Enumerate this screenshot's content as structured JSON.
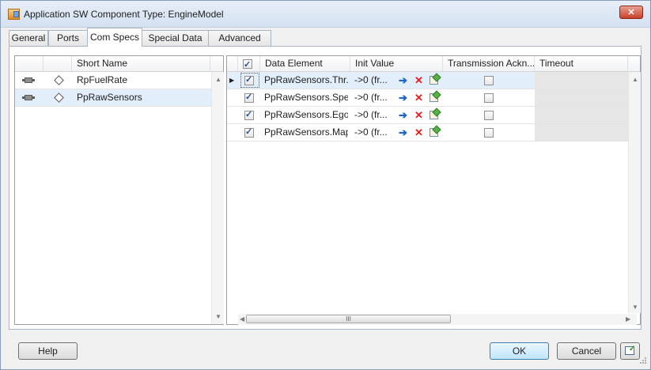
{
  "window": {
    "title": "Application SW Component Type: EngineModel",
    "close_symbol": "✕"
  },
  "tabs": [
    {
      "label": "General",
      "active": false
    },
    {
      "label": "Ports",
      "active": false
    },
    {
      "label": "Com Specs",
      "active": true
    },
    {
      "label": "Special Data",
      "active": false
    },
    {
      "label": "Advanced",
      "active": false
    }
  ],
  "left_table": {
    "header": "Short Name",
    "rows": [
      {
        "name": "RpFuelRate",
        "selected": false
      },
      {
        "name": "PpRawSensors",
        "selected": true
      }
    ]
  },
  "right_table": {
    "headers": {
      "select_all_checked": true,
      "data_element": "Data Element",
      "init_value": "Init Value",
      "transmission_ack": "Transmission Ackn...",
      "timeout": "Timeout"
    },
    "rows": [
      {
        "checked": true,
        "data_element": "PpRawSensors.Thr...",
        "init_value": "->0 (fr...",
        "transmission_ack": false,
        "current": true
      },
      {
        "checked": true,
        "data_element": "PpRawSensors.Spe...",
        "init_value": "->0 (fr...",
        "transmission_ack": false,
        "current": false
      },
      {
        "checked": true,
        "data_element": "PpRawSensors.Ego",
        "init_value": "->0 (fr...",
        "transmission_ack": false,
        "current": false
      },
      {
        "checked": true,
        "data_element": "PpRawSensors.Map",
        "init_value": "->0 (fr...",
        "transmission_ack": false,
        "current": false
      }
    ],
    "scroll_thumb_grip": "III"
  },
  "icons": {
    "assign": "assign-icon",
    "delete": "delete-icon",
    "edit": "edit-icon"
  },
  "buttons": {
    "help": "Help",
    "ok": "OK",
    "cancel": "Cancel"
  },
  "colors": {
    "selection": "#e3eefb",
    "close_red": "#c8402a",
    "delete_red": "#e02020",
    "accent_blue": "#1f64c8"
  }
}
